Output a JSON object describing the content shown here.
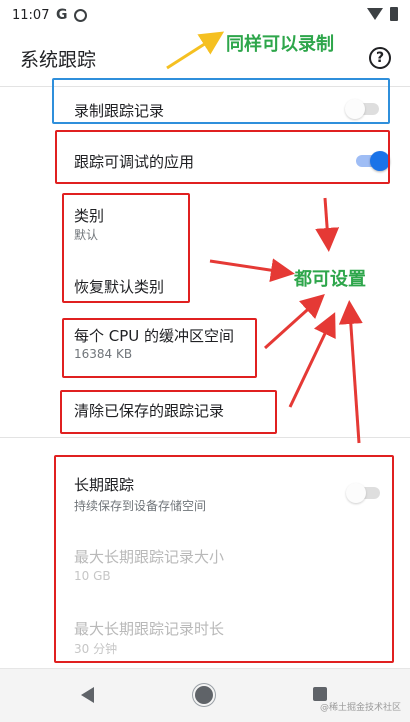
{
  "status_bar": {
    "time": "11:07",
    "app_icon_letter": "G",
    "icons": [
      "google-icon",
      "circle-app-icon",
      "wifi-icon",
      "battery-icon"
    ]
  },
  "app_bar": {
    "title": "系统跟踪",
    "help_glyph": "?"
  },
  "preferences": {
    "record_trace": {
      "title": "录制跟踪记录",
      "enabled": false
    },
    "trace_debuggable_apps": {
      "title": "跟踪可调试的应用",
      "enabled": true
    },
    "categories": {
      "title": "类别",
      "summary": "默认"
    },
    "restore_default_categories": {
      "title": "恢复默认类别"
    },
    "buffer_size": {
      "title": "每个 CPU 的缓冲区空间",
      "summary": "16384 KB"
    },
    "clear_saved_traces": {
      "title": "清除已保存的跟踪记录"
    },
    "long_traces": {
      "title": "长期跟踪",
      "summary": "持续保存到设备存储空间",
      "enabled": false
    },
    "max_long_trace_size": {
      "title": "最大长期跟踪记录大小",
      "summary": "10 GB"
    },
    "max_long_trace_duration": {
      "title": "最大长期跟踪记录时长",
      "summary": "30 分钟"
    }
  },
  "annotations": {
    "top_note": "同样可以录制",
    "side_note": "都可设置",
    "note_color": "#2ea64b",
    "arrow_color": "#e53935",
    "highlight_colors": {
      "blue": "#2f8fdb",
      "red": "#e02020",
      "yellow": "#f5c021"
    }
  },
  "nav_bar": {
    "icons": [
      "back-icon",
      "home-icon",
      "recents-icon"
    ]
  },
  "watermark": "@稀土掘金技术社区",
  "colors": {
    "accent": "#1a73e8",
    "switch_off_track": "#c4c4c4"
  }
}
